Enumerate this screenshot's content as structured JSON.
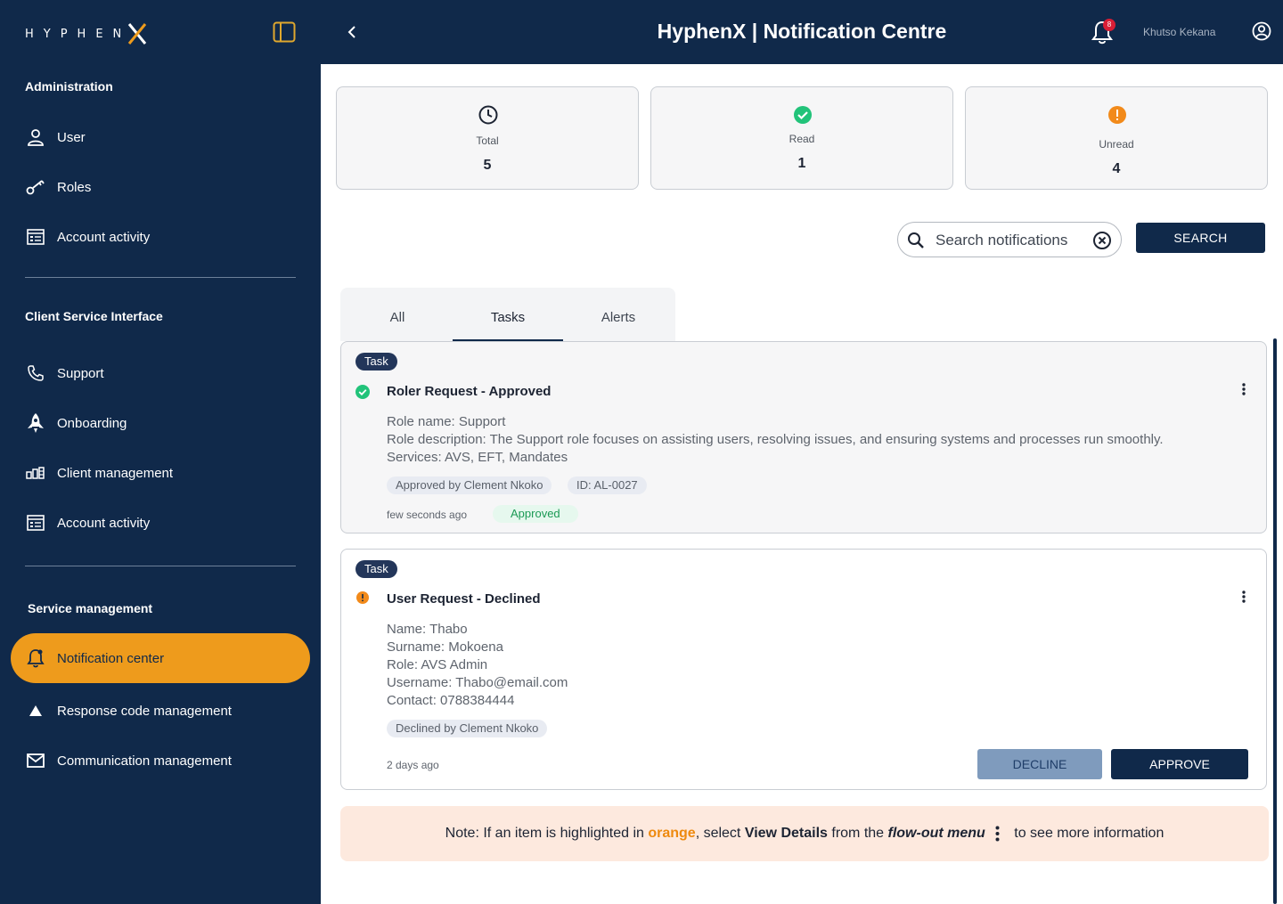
{
  "app": {
    "logo_text": "HYPHEN",
    "logo_x": "X"
  },
  "sidebar": {
    "sections": [
      {
        "title": "Administration",
        "items": [
          {
            "label": "User",
            "icon": "user-icon"
          },
          {
            "label": "Roles",
            "icon": "key-icon"
          },
          {
            "label": "Account activity",
            "icon": "activity-list-icon"
          }
        ]
      },
      {
        "title": "Client Service Interface",
        "items": [
          {
            "label": "Support",
            "icon": "phone-icon"
          },
          {
            "label": "Onboarding",
            "icon": "rocket-icon"
          },
          {
            "label": "Client management",
            "icon": "client-management-icon"
          },
          {
            "label": "Account activity",
            "icon": "activity-list-icon"
          }
        ]
      },
      {
        "title": "Service management",
        "items": [
          {
            "label": "Notification center",
            "icon": "bell-icon",
            "active": true
          },
          {
            "label": "Response code management",
            "icon": "triangle-icon"
          },
          {
            "label": "Communication management",
            "icon": "mail-icon"
          }
        ]
      }
    ]
  },
  "header": {
    "title": "HyphenX | Notification Centre",
    "badge_count": "8",
    "user_name": "Khutso Kekana"
  },
  "stats": {
    "total": {
      "label": "Total",
      "value": "5"
    },
    "read": {
      "label": "Read",
      "value": "1"
    },
    "unread": {
      "label": "Unread",
      "value": "4"
    }
  },
  "search": {
    "placeholder": "Search notifications",
    "button_label": "SEARCH"
  },
  "tabs": [
    {
      "label": "All"
    },
    {
      "label": "Tasks",
      "active": true
    },
    {
      "label": "Alerts"
    }
  ],
  "notifications": [
    {
      "type": "Task",
      "title": "Roler Request - Approved",
      "details": [
        "Role name: Support",
        "Role description: The Support role focuses on assisting users, resolving issues, and ensuring systems and processes run smoothly.",
        "Services: AVS, EFT, Mandates"
      ],
      "chips": [
        "Approved by Clement Nkoko",
        "ID: AL-0027"
      ],
      "time": "few seconds ago",
      "status": "Approved"
    },
    {
      "type": "Task",
      "title": "User Request - Declined",
      "details": [
        "Name: Thabo",
        "Surname: Mokoena",
        "Role: AVS Admin",
        "Username: Thabo@email.com",
        "Contact: 0788384444"
      ],
      "chips": [
        "Declined by Clement Nkoko"
      ],
      "time": "2 days ago",
      "decline_label": "DECLINE",
      "approve_label": "APPROVE"
    }
  ],
  "note": {
    "prefix": "Note: If an item is highlighted in ",
    "orange": "orange",
    "middle1": ", select ",
    "view_details": "View Details",
    "middle2": " from the ",
    "flow_out": "flow-out menu",
    "suffix": " to see more information"
  },
  "colors": {
    "navy": "#10294a",
    "accent_orange": "#ee9b1c",
    "success_green": "#22c37a",
    "warning_orange": "#f28a1a",
    "badge_red": "#d81e35"
  }
}
